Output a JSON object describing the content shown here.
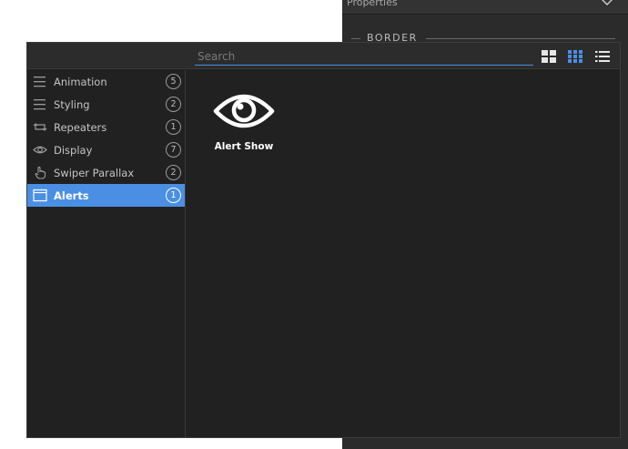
{
  "properties": {
    "title": "Properties",
    "section_label": "BORDER"
  },
  "search": {
    "placeholder": "Search",
    "value": ""
  },
  "view_modes": [
    "large-grid",
    "small-grid",
    "list"
  ],
  "active_view_mode": "small-grid",
  "categories": [
    {
      "label": "Animation",
      "count": "5",
      "icon": "hamburger-icon"
    },
    {
      "label": "Styling",
      "count": "2",
      "icon": "hamburger-icon"
    },
    {
      "label": "Repeaters",
      "count": "1",
      "icon": "repeat-icon"
    },
    {
      "label": "Display",
      "count": "7",
      "icon": "eye-icon"
    },
    {
      "label": "Swiper Parallax",
      "count": "2",
      "icon": "hand-pointer-icon"
    },
    {
      "label": "Alerts",
      "count": "1",
      "icon": "window-icon"
    }
  ],
  "active_category": "Alerts",
  "items": [
    {
      "label": "Alert Show",
      "icon": "eye-icon"
    }
  ],
  "colors": {
    "accent": "#4b8fe4",
    "panel_bg": "#212121",
    "topbar_bg": "#2c2c2c"
  }
}
